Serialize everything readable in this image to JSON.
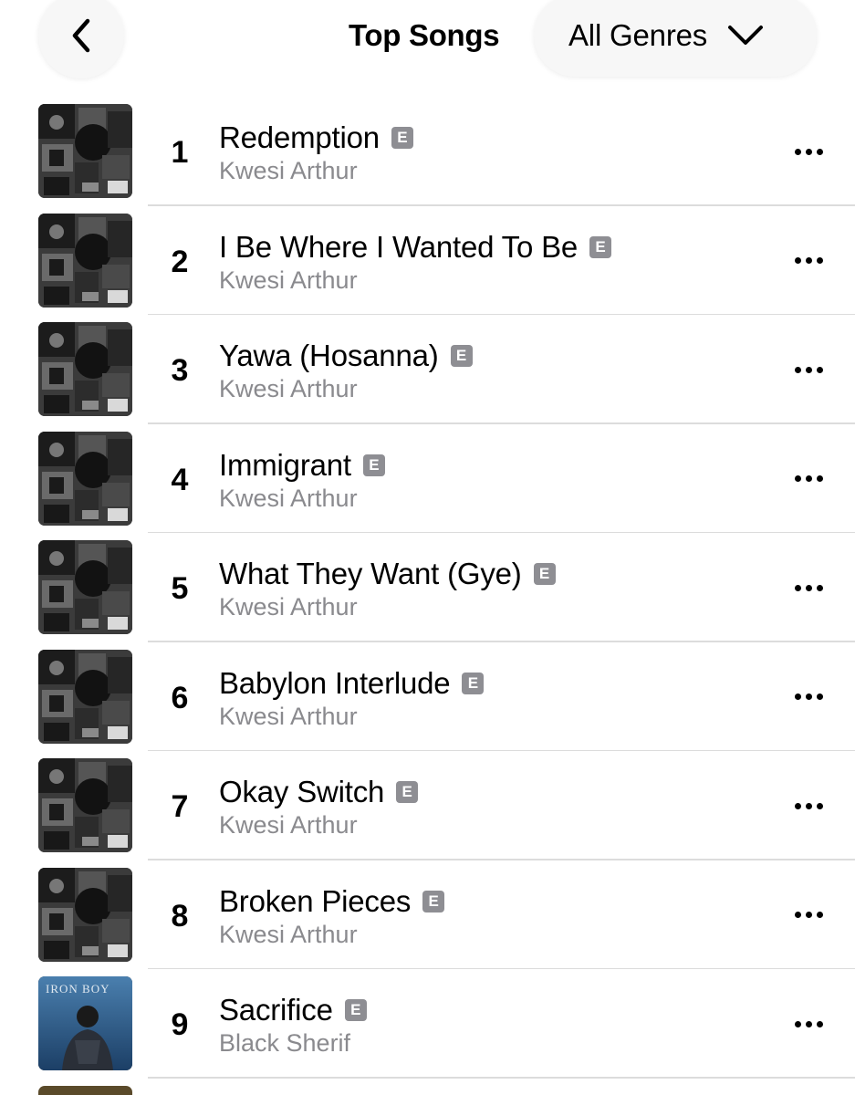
{
  "header": {
    "back_icon": "chevron-left-icon",
    "title": "Top Songs",
    "genre_label": "All Genres",
    "genre_icon": "chevron-down-icon"
  },
  "explicit_badge": "E",
  "songs": [
    {
      "rank": "1",
      "title": "Redemption",
      "artist": "Kwesi Arthur",
      "artwork": "dark-collage"
    },
    {
      "rank": "2",
      "title": "I Be Where I Wanted To Be",
      "artist": "Kwesi Arthur",
      "artwork": "dark-collage"
    },
    {
      "rank": "3",
      "title": "Yawa (Hosanna)",
      "artist": "Kwesi Arthur",
      "artwork": "dark-collage"
    },
    {
      "rank": "4",
      "title": "Immigrant",
      "artist": "Kwesi Arthur",
      "artwork": "dark-collage"
    },
    {
      "rank": "5",
      "title": "What They Want (Gye)",
      "artist": "Kwesi Arthur",
      "artwork": "dark-collage"
    },
    {
      "rank": "6",
      "title": "Babylon Interlude",
      "artist": "Kwesi Arthur",
      "artwork": "dark-collage"
    },
    {
      "rank": "7",
      "title": "Okay Switch",
      "artist": "Kwesi Arthur",
      "artwork": "dark-collage"
    },
    {
      "rank": "8",
      "title": "Broken Pieces",
      "artist": "Kwesi Arthur",
      "artwork": "dark-collage"
    },
    {
      "rank": "9",
      "title": "Sacrifice",
      "artist": "Black Sherif",
      "artwork": "blue-ironboy",
      "artwork_text": "IRON BOY"
    }
  ],
  "colors": {
    "artist_gray": "#8a8a8e",
    "badge_gray": "#8e8e93",
    "divider": "#dcdcdc"
  }
}
